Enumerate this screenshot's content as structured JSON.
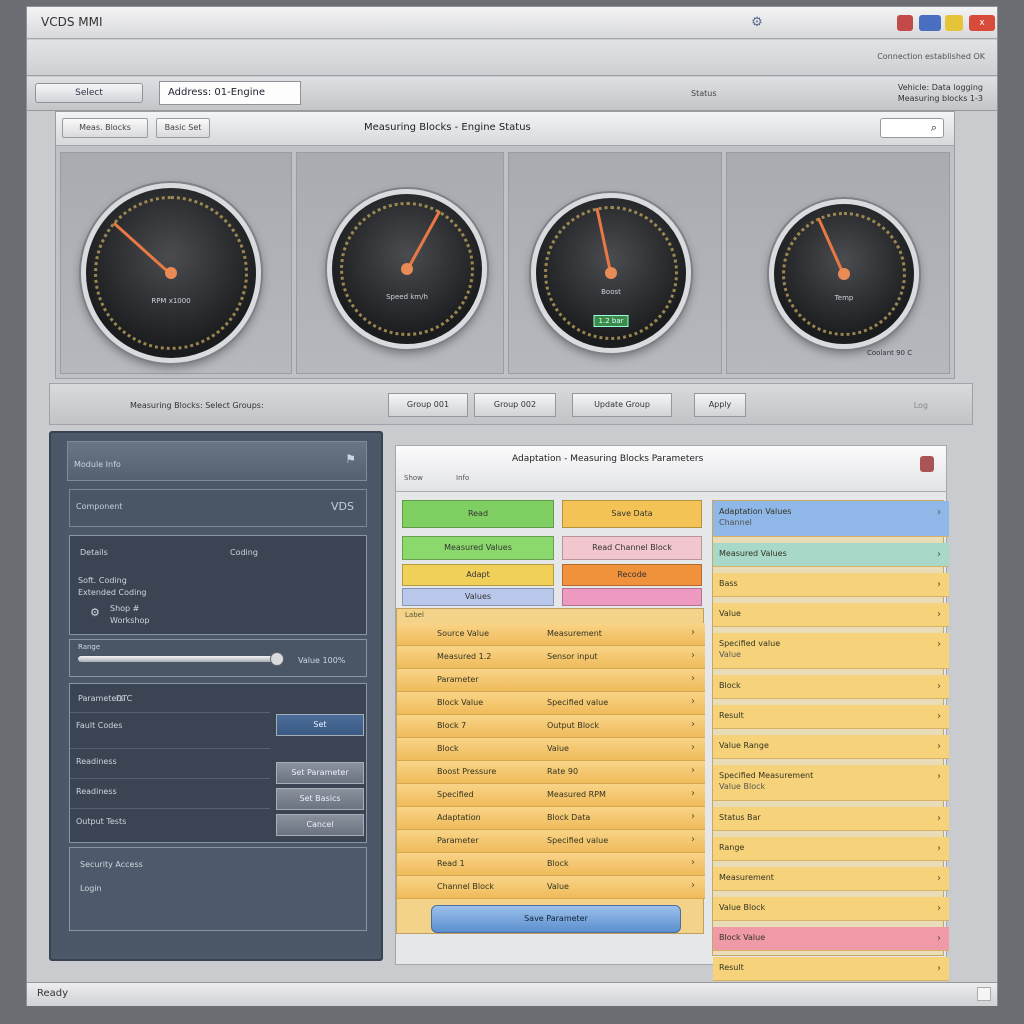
{
  "window": {
    "title": "VCDS MMI",
    "title_icon": "tool-icon"
  },
  "titlebar_buttons": [
    {
      "name": "help-button",
      "color": "#c24a4a"
    },
    {
      "name": "info-button",
      "color": "#4a6fc0"
    },
    {
      "name": "minimize-button",
      "color": "#e6c43a"
    },
    {
      "name": "close-button",
      "color": "#d84a3a",
      "label": "x"
    }
  ],
  "menubar": {
    "right_text": "Connection established OK"
  },
  "toolbar": {
    "button_label": "Select",
    "address_value": "Address: 01-Engine",
    "mid_text": "Status",
    "right_text_1": "Vehicle: Data logging",
    "right_text_2": "Measuring blocks 1-3"
  },
  "gauge_panel": {
    "header_buttons": [
      "Meas. Blocks",
      "Basic Set"
    ],
    "title": "Measuring Blocks - Engine Status",
    "search_label": "Go",
    "search_icon": "search-icon",
    "gauges": [
      {
        "label": "RPM x1000",
        "badge": "",
        "caption": "",
        "value_fraction": 0.3
      },
      {
        "label": "Speed km/h",
        "badge": "",
        "caption": "",
        "value_fraction": 0.62
      },
      {
        "label": "Boost",
        "badge": "1.2 bar",
        "caption": "",
        "value_fraction": 0.45
      },
      {
        "label": "Temp",
        "badge": "",
        "caption": "Coolant 90 C",
        "value_fraction": 0.4
      }
    ]
  },
  "filter_bar": {
    "label": "Measuring Blocks: Select Groups:",
    "buttons": [
      "Group 001",
      "Group 002",
      "Update Group",
      "Apply"
    ],
    "right_text": "Log"
  },
  "left_panel": {
    "header": "Module Info",
    "header_icon": "flag-icon",
    "row1_label": "Component",
    "row1_value": "VDS",
    "box1_title": "Details",
    "box1_subtitle": "Coding",
    "box1_lines": [
      "Soft. Coding",
      "Extended Coding"
    ],
    "box1_small": [
      "Shop #",
      "Workshop"
    ],
    "slider_label": "Range",
    "slider_value": "Value 100%",
    "table_title": "Parameters",
    "table_value": "DTC",
    "table_rows": [
      "Fault Codes",
      "Readiness",
      "Readiness",
      "Output Tests"
    ],
    "table_buttons": [
      "Set",
      "Set Parameter",
      "Set Basics",
      "Cancel"
    ],
    "footer_lines": [
      "Security Access",
      "Login"
    ]
  },
  "main_panel": {
    "title": "Adaptation - Measuring Blocks Parameters",
    "tab": "Show",
    "tab2": "Info",
    "header_icon": "document-icon",
    "tiles": [
      {
        "label": "Read",
        "color": "#7fcf62"
      },
      {
        "label": "Save Data",
        "color": "#f3c355"
      },
      {
        "label": "Measured Values",
        "color": "#8bd86c"
      },
      {
        "label": "Read Channel Block",
        "color": "#f2c6cf"
      },
      {
        "label": "Adapt",
        "color": "#f1d05a"
      },
      {
        "label": "Recode",
        "color": "#f0913c"
      },
      {
        "label": "Values",
        "color": "#b9c8ea"
      },
      {
        "label": "",
        "color": "#ee9ac0"
      }
    ],
    "grid_header": "Label",
    "grid_rows": [
      {
        "c1": "Source Value",
        "c2": "Measurement"
      },
      {
        "c1": "Measured 1.2",
        "c2": "Sensor input"
      },
      {
        "c1": "Parameter",
        "c2": ""
      },
      {
        "c1": "Block Value",
        "c2": "Specified value"
      },
      {
        "c1": "Block 7",
        "c2": "Output Block"
      },
      {
        "c1": "Block",
        "c2": "Value"
      },
      {
        "c1": "Boost Pressure",
        "c2": "Rate 90"
      },
      {
        "c1": "Specified",
        "c2": "Measured RPM"
      },
      {
        "c1": "Adaptation",
        "c2": "Block Data"
      },
      {
        "c1": "Parameter",
        "c2": "Specified value"
      },
      {
        "c1": "Read 1",
        "c2": "Block"
      },
      {
        "c1": "Channel Block",
        "c2": "Value"
      }
    ],
    "grid_button": "Save Parameter",
    "right_list": [
      {
        "text": "Adaptation Values",
        "sub": "Channel",
        "color": "#8fb7e8"
      },
      {
        "text": "Measured Values",
        "sub": "",
        "color": "#a8d8c8"
      },
      {
        "text": "Bass",
        "sub": "",
        "color": "#f6d37a"
      },
      {
        "text": "Value",
        "sub": "",
        "color": "#f6d37a"
      },
      {
        "text": "Specified value",
        "sub": "Value",
        "color": "#f6d37a"
      },
      {
        "text": "Block",
        "sub": "",
        "color": "#f6d37a"
      },
      {
        "text": "Result",
        "sub": "",
        "color": "#f6d37a"
      },
      {
        "text": "Value Range",
        "sub": "",
        "color": "#f6d37a"
      },
      {
        "text": "Specified Measurement",
        "sub": "Value Block",
        "color": "#f6d37a"
      },
      {
        "text": "Status Bar",
        "sub": "",
        "color": "#f6d37a"
      },
      {
        "text": "Range",
        "sub": "",
        "color": "#f6d37a"
      },
      {
        "text": "Measurement",
        "sub": "",
        "color": "#f6d37a"
      },
      {
        "text": "Value Block",
        "sub": "",
        "color": "#f6d37a"
      },
      {
        "text": "Block Value",
        "sub": "",
        "color": "#f09aa8"
      },
      {
        "text": "Result",
        "sub": "",
        "color": "#f6d37a"
      }
    ]
  },
  "statusbar": {
    "text": "Ready"
  }
}
